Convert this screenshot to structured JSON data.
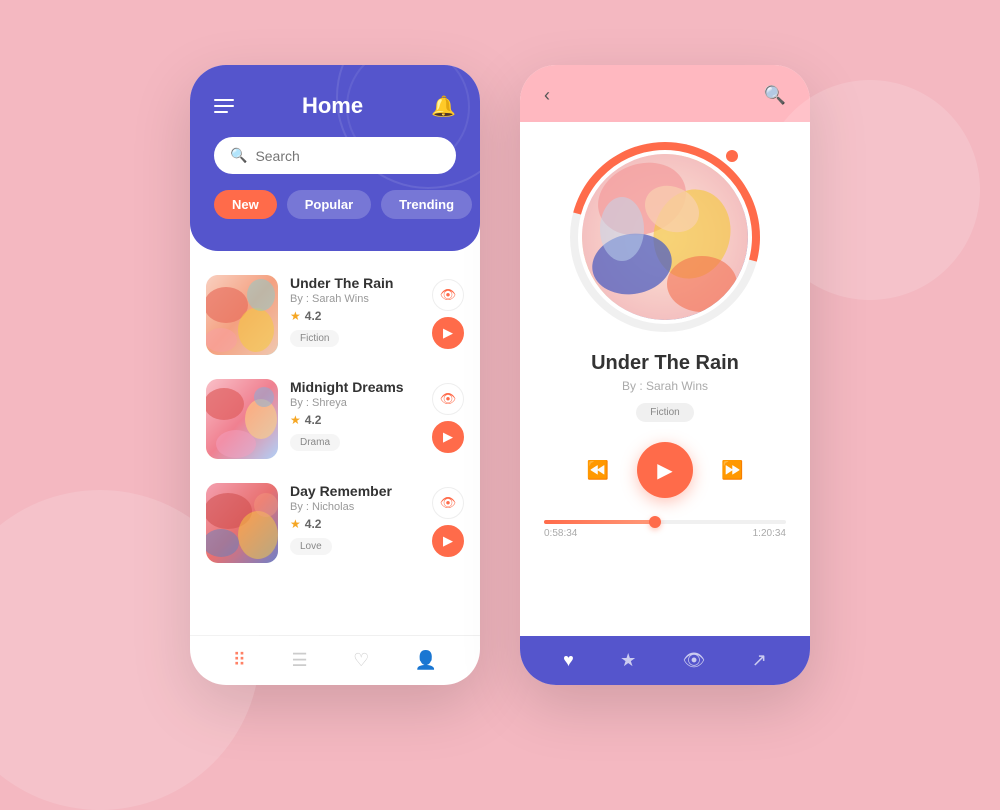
{
  "background": "#f4b8c1",
  "left_phone": {
    "header": {
      "title": "Home",
      "search_placeholder": "Search"
    },
    "filter_tabs": [
      {
        "label": "New",
        "active": true
      },
      {
        "label": "Popular",
        "active": false
      },
      {
        "label": "Trending",
        "active": false
      }
    ],
    "books": [
      {
        "id": 1,
        "title": "Under The Rain",
        "author": "By : Sarah Wins",
        "rating": "4.2",
        "tag": "Fiction",
        "cover_style": "1"
      },
      {
        "id": 2,
        "title": "Midnight Dreams",
        "author": "By : Shreya",
        "rating": "4.2",
        "tag": "Drama",
        "cover_style": "2"
      },
      {
        "id": 3,
        "title": "Day Remember",
        "author": "By : Nicholas",
        "rating": "4.2",
        "tag": "Love",
        "cover_style": "3"
      }
    ],
    "bottom_nav": [
      "grid-icon",
      "list-icon",
      "heart-icon",
      "user-icon"
    ]
  },
  "right_phone": {
    "now_playing": {
      "title": "Under The Rain",
      "author": "By : Sarah Wins",
      "tag": "Fiction",
      "current_time": "0:58:34",
      "total_time": "1:20:34",
      "progress_percent": 46
    },
    "bottom_nav": [
      "heart-icon",
      "star-icon",
      "eye-icon",
      "share-icon"
    ]
  }
}
